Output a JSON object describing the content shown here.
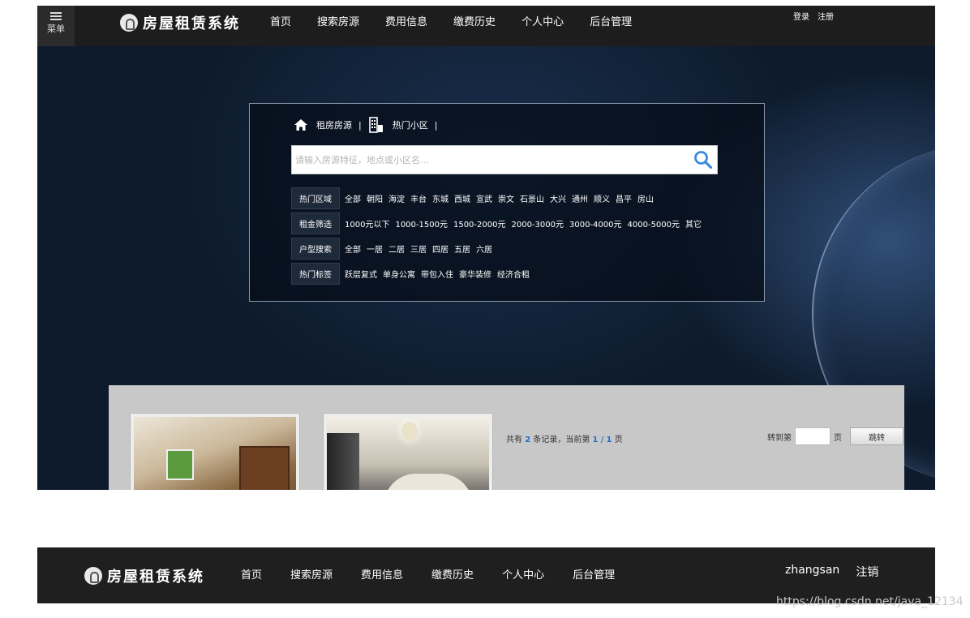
{
  "site": {
    "name": "房屋租赁系统"
  },
  "menu": {
    "label": "菜单"
  },
  "nav": [
    "首页",
    "搜索房源",
    "费用信息",
    "缴费历史",
    "个人中心",
    "后台管理"
  ],
  "auth": {
    "login": "登录",
    "register": "注册"
  },
  "search": {
    "tab_rent": "租房房源",
    "tab_hot_community": "热门小区",
    "placeholder": "请输入房源特征，地点或小区名...",
    "value": ""
  },
  "filters": [
    {
      "label": "热门区域",
      "options": [
        "全部",
        "朝阳",
        "海淀",
        "丰台",
        "东城",
        "西城",
        "宣武",
        "崇文",
        "石景山",
        "大兴",
        "通州",
        "顺义",
        "昌平",
        "房山"
      ]
    },
    {
      "label": "租金筛选",
      "options": [
        "1000元以下",
        "1000-1500元",
        "1500-2000元",
        "2000-3000元",
        "3000-4000元",
        "4000-5000元",
        "其它"
      ]
    },
    {
      "label": "户型搜索",
      "options": [
        "全部",
        "一居",
        "二居",
        "三居",
        "四居",
        "五居",
        "六居"
      ]
    },
    {
      "label": "热门标签",
      "options": [
        "跃层复式",
        "单身公寓",
        "带包入住",
        "豪华装修",
        "经济合租"
      ]
    }
  ],
  "listing": {
    "records_prefix": "共有",
    "total": "2",
    "records_mid": "条记录，当前第",
    "current_page": "1",
    "slash": "/",
    "total_pages": "1",
    "records_suffix": "页",
    "goto_prefix": "转到第",
    "goto_value": "",
    "goto_suffix": "页",
    "goto_button": "跳转"
  },
  "logged_in": {
    "username": "zhangsan",
    "logout": "注销"
  },
  "watermark": "https://blog.csdn.net/java_12134",
  "colors": {
    "nav_bg": "#1d1d1d",
    "hero_bg": "#0e1b2d",
    "panel_bg": "#c8c8c8",
    "accent": "#1f6fcf"
  }
}
